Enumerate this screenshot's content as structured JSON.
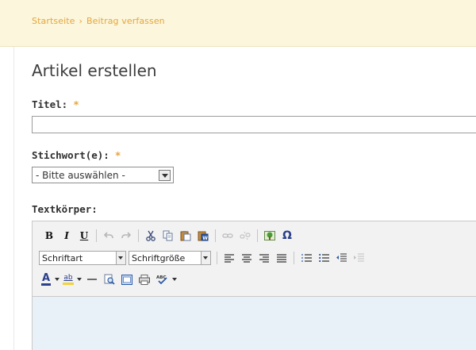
{
  "breadcrumb": {
    "home": "Startseite",
    "separator": "›",
    "current": "Beitrag verfassen"
  },
  "page_title": "Artikel erstellen",
  "form": {
    "title_label": "Titel:",
    "tags_label": "Stichwort(e):",
    "required_marker": "*",
    "tags_select_value": "- Bitte auswählen -",
    "body_label": "Textkörper:"
  },
  "editor": {
    "toolbar": {
      "bold": "B",
      "italic": "I",
      "underline": "U",
      "font_combo": "Schriftart",
      "size_combo": "Schriftgröße",
      "omega": "Ω",
      "font_color": "A",
      "highlight": "ab"
    },
    "icons": [
      "bold-icon",
      "italic-icon",
      "underline-icon",
      "undo-icon",
      "redo-icon",
      "cut-icon",
      "copy-icon",
      "paste-icon",
      "paste-word-icon",
      "link-icon",
      "unlink-icon",
      "image-icon",
      "special-char-icon",
      "align-left-icon",
      "align-center-icon",
      "align-right-icon",
      "align-justify-icon",
      "numbered-list-icon",
      "bullet-list-icon",
      "indent-icon",
      "outdent-icon",
      "font-color-icon",
      "highlight-icon",
      "horizontal-rule-icon",
      "preview-icon",
      "fullscreen-icon",
      "print-icon",
      "spellcheck-icon"
    ]
  },
  "colors": {
    "breadcrumb_bg": "#fcf6dc",
    "breadcrumb_text": "#e4a63a",
    "required": "#e8a43a",
    "editor_body": "#e8f0f8"
  }
}
